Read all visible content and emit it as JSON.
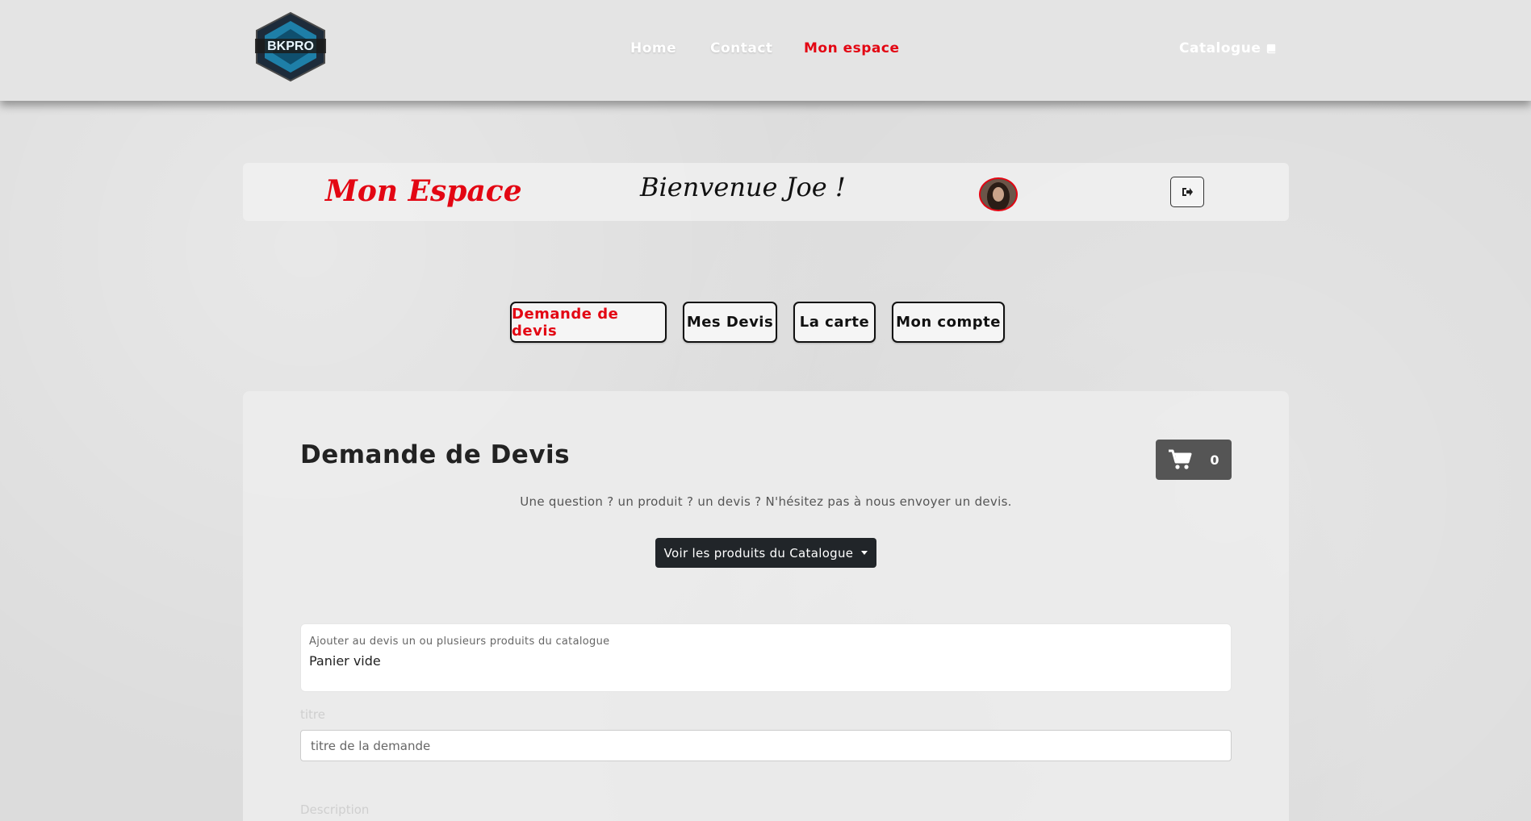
{
  "nav": {
    "logo_text": "BKPRO",
    "links": [
      "Home",
      "Contact",
      "Mon espace"
    ],
    "catalogue_label": "Catalogue"
  },
  "header": {
    "space_title": "Mon Espace",
    "welcome": "Bienvenue Joe !"
  },
  "tabs": [
    "Demande de devis",
    "Mes Devis",
    "La carte",
    "Mon compte"
  ],
  "main": {
    "title": "Demande de Devis",
    "cart_count": "0",
    "subtitle": "Une question ? un produit ? un devis ? N'hésitez pas à nous envoyer un devis.",
    "catalogue_button": "Voir les produits du Catalogue",
    "cart_box_label": "Ajouter au devis un ou plusieurs produits du catalogue",
    "cart_box_value": "Panier vide",
    "title_label": "titre",
    "title_placeholder": "titre de la demande",
    "description_label": "Description"
  },
  "colors": {
    "accent": "#e30613",
    "dark_button": "#212529",
    "cart_button": "#555555"
  }
}
